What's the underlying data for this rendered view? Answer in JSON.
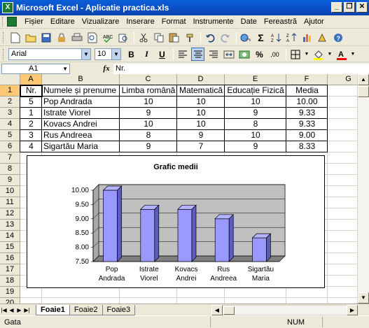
{
  "window": {
    "title": "Microsoft Excel - Aplicatie practica.xls",
    "app_icon_letter": "X",
    "controls": [
      "minimize",
      "restore",
      "close"
    ]
  },
  "menu": [
    "Fișier",
    "Editare",
    "Vizualizare",
    "Inserare",
    "Format",
    "Instrumente",
    "Date",
    "Fereastră",
    "Ajutor"
  ],
  "toolbar_font": {
    "font_name": "Arial",
    "font_size": "10"
  },
  "formula_bar": {
    "name_box": "A1",
    "fx_label": "fx",
    "content": "Nr."
  },
  "columns": [
    "A",
    "B",
    "C",
    "D",
    "E",
    "F",
    "G"
  ],
  "rows": [
    "1",
    "2",
    "3",
    "4",
    "5",
    "6",
    "7",
    "8",
    "9",
    "10",
    "11",
    "12",
    "13",
    "14",
    "15",
    "16",
    "17",
    "18",
    "19",
    "20"
  ],
  "table": {
    "headers": [
      "Nr.",
      "Numele și prenume",
      "Limba română",
      "Matematică",
      "Educație Fizică",
      "Media"
    ],
    "rows": [
      [
        "5",
        "Pop Andrada",
        "10",
        "10",
        "10",
        "10.00"
      ],
      [
        "1",
        "Istrate Viorel",
        "9",
        "10",
        "9",
        "9.33"
      ],
      [
        "2",
        "Kovacs Andrei",
        "10",
        "10",
        "8",
        "9.33"
      ],
      [
        "3",
        "Rus Andreea",
        "8",
        "9",
        "10",
        "9.00"
      ],
      [
        "4",
        "Sigartău Maria",
        "9",
        "7",
        "9",
        "8.33"
      ]
    ]
  },
  "chart_data": {
    "type": "bar",
    "title": "Grafic medii",
    "categories": [
      "Pop Andrada",
      "Istrate Viorel",
      "Kovacs Andrei",
      "Rus Andreea",
      "Sigartău Maria"
    ],
    "category_lines": [
      [
        "Pop",
        "Andrada"
      ],
      [
        "Istrate",
        "Viorel"
      ],
      [
        "Kovacs",
        "Andrei"
      ],
      [
        "Rus",
        "Andreea"
      ],
      [
        "Sigartău",
        "Maria"
      ]
    ],
    "values": [
      10.0,
      9.33,
      9.33,
      9.0,
      8.33
    ],
    "yticks": [
      "10.00",
      "9.50",
      "9.00",
      "8.50",
      "8.00",
      "7.50"
    ],
    "ylim": [
      7.5,
      10
    ],
    "style": "3d-column",
    "grid": true,
    "legend": "none",
    "bar_color": "#9999ff",
    "wall_color": "#c0c0c0",
    "floor_color": "#808080"
  },
  "sheets": [
    "Foaie1",
    "Foaie2",
    "Foaie3"
  ],
  "active_sheet": "Foaie1",
  "status": {
    "mode": "Gata",
    "num": "NUM"
  },
  "colors": {
    "title_bar": "#0b52c9",
    "selected_header": "#ffc875",
    "excel_green": "#1d7a35"
  }
}
